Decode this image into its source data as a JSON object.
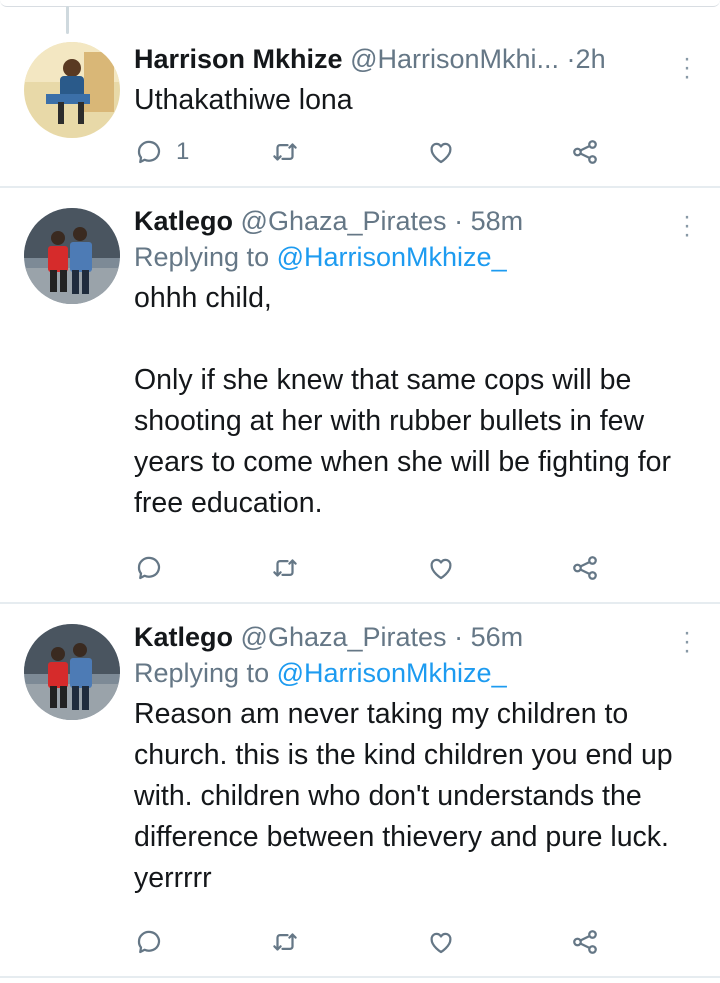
{
  "tweets": [
    {
      "name": "Harrison Mkhize",
      "handle": "@HarrisonMkhi...",
      "sep": "·",
      "time": "2h",
      "replying_to": "",
      "text": "Uthakathiwe lona",
      "reply_count": "1",
      "avatar_icon": "profile-photo"
    },
    {
      "name": "Katlego",
      "handle": "@Ghaza_Pirates",
      "sep": "·",
      "time": "58m",
      "replying_label": "Replying to",
      "replying_to": "@HarrisonMkhize_",
      "text": "ohhh child,\n\nOnly if she knew that same cops will be shooting at her with rubber bullets in few years to come when she will be fighting for free education.",
      "reply_count": "",
      "avatar_icon": "profile-photo"
    },
    {
      "name": "Katlego",
      "handle": "@Ghaza_Pirates",
      "sep": "·",
      "time": "56m",
      "replying_label": "Replying to",
      "replying_to": "@HarrisonMkhize_",
      "text": "Reason am never taking my children to church. this is the kind children you end up with. children who don't understands the difference between thievery and pure luck. yerrrrr",
      "reply_count": "",
      "avatar_icon": "profile-photo"
    }
  ],
  "colors": {
    "text": "#14171a",
    "secondary": "#657786",
    "link": "#1d9bf0",
    "divider": "#e6ecf0"
  },
  "icons": [
    "reply-icon",
    "retweet-icon",
    "like-icon",
    "share-icon",
    "more-options-icon"
  ]
}
